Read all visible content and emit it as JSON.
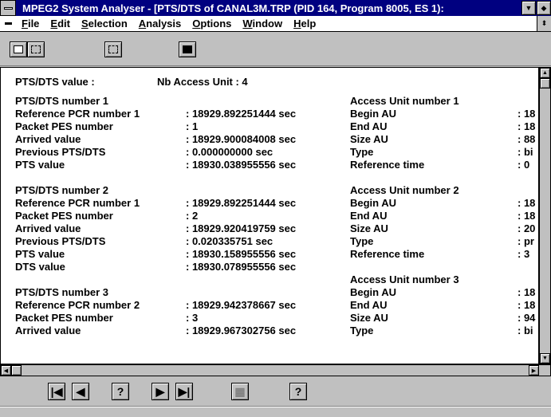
{
  "window": {
    "title": "MPEG2 System Analyser - [PTS/DTS of CANAL3M.TRP (PID 164, Program 8005, ES 1):"
  },
  "menu": [
    {
      "u": "F",
      "rest": "ile"
    },
    {
      "u": "E",
      "rest": "dit"
    },
    {
      "u": "S",
      "rest": "election"
    },
    {
      "u": "A",
      "rest": "nalysis"
    },
    {
      "u": "O",
      "rest": "ptions"
    },
    {
      "u": "W",
      "rest": "indow"
    },
    {
      "u": "H",
      "rest": "elp"
    }
  ],
  "header": {
    "label": "PTS/DTS value :",
    "nb_access": "Nb Access Unit : 4"
  },
  "lines": [
    [
      "PTS/DTS number 1",
      "",
      "Access Unit number 1",
      ""
    ],
    [
      "Reference PCR number 1",
      ": 18929.892251444 sec",
      "Begin AU",
      ": 18"
    ],
    [
      "Packet PES number",
      ": 1",
      "End AU",
      ": 18"
    ],
    [
      "Arrived value",
      ": 18929.900084008 sec",
      "Size AU",
      ": 88"
    ],
    [
      "Previous PTS/DTS",
      ": 0.000000000 sec",
      "Type",
      ": bi"
    ],
    [
      "PTS value",
      ": 18930.038955556 sec",
      "Reference time",
      ": 0"
    ],
    [
      "",
      "",
      "",
      ""
    ],
    [
      "PTS/DTS number 2",
      "",
      "Access Unit number 2",
      ""
    ],
    [
      "Reference PCR number 1",
      ": 18929.892251444 sec",
      "Begin AU",
      ": 18"
    ],
    [
      "Packet PES number",
      ": 2",
      "End AU",
      ": 18"
    ],
    [
      "Arrived value",
      ": 18929.920419759 sec",
      "Size AU",
      ": 20"
    ],
    [
      "Previous PTS/DTS",
      ": 0.020335751 sec",
      "Type",
      ": pr"
    ],
    [
      "PTS value",
      ": 18930.158955556 sec",
      "Reference time",
      ": 3"
    ],
    [
      "DTS value",
      ": 18930.078955556 sec",
      "",
      ""
    ],
    [
      "",
      "",
      "Access Unit number 3",
      ""
    ],
    [
      "PTS/DTS number 3",
      "",
      "Begin AU",
      ": 18"
    ],
    [
      "Reference PCR number 2",
      ": 18929.942378667 sec",
      "End AU",
      ": 18"
    ],
    [
      "Packet PES number",
      ": 3",
      "Size AU",
      ": 94"
    ],
    [
      "Arrived value",
      ": 18929.967302756 sec",
      "Type",
      ": bi"
    ]
  ],
  "nav": {
    "help_label": "?",
    "query_label": "?"
  },
  "colors": {
    "title_bar": "#000080",
    "chrome": "#c0c0c0"
  }
}
